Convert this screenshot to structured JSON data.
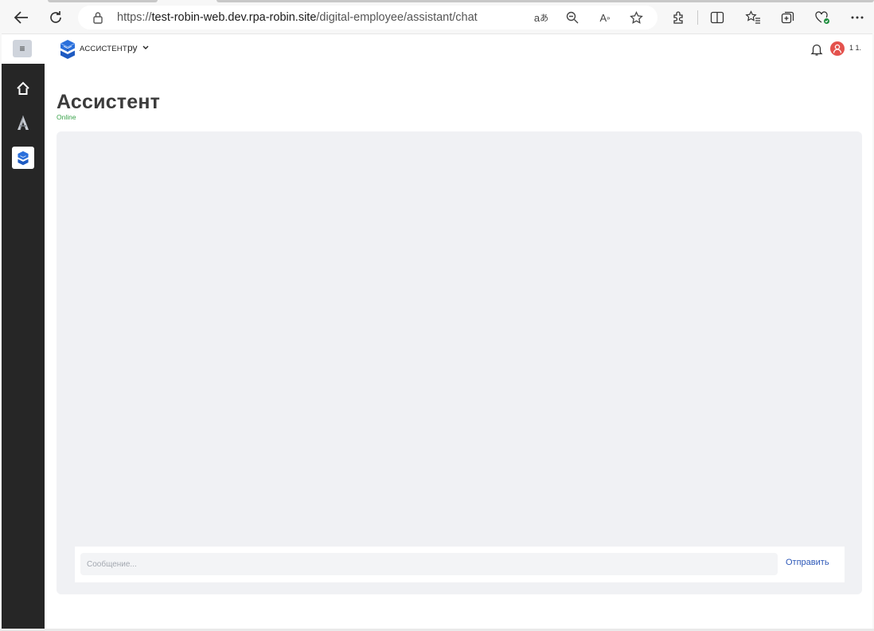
{
  "browser": {
    "url_prefix": "https://",
    "url_host": "test-robin-web.dev.rpa-robin.site",
    "url_path": "/digital-employee/assistant/chat"
  },
  "topbar": {
    "brand": "ассистент",
    "language": "ру",
    "user_short": "1 1."
  },
  "sidebar": {
    "menu_label": "≡",
    "items": [
      {
        "name": "home",
        "icon": "house-icon"
      },
      {
        "name": "robin",
        "icon": "robin-a-icon"
      },
      {
        "name": "assistant",
        "icon": "cube-logo-icon",
        "active": true
      }
    ]
  },
  "main": {
    "title": "Ассистент",
    "status": "Online",
    "status_color": "#3aa34b"
  },
  "composer": {
    "placeholder": "Сообщение...",
    "value": "",
    "send_label": "Отправить"
  },
  "colors": {
    "sidebar_bg": "#262626",
    "chat_bg": "#f0f1f4",
    "accent": "#2d58b8",
    "logo_blue": "#2a6fdb"
  }
}
